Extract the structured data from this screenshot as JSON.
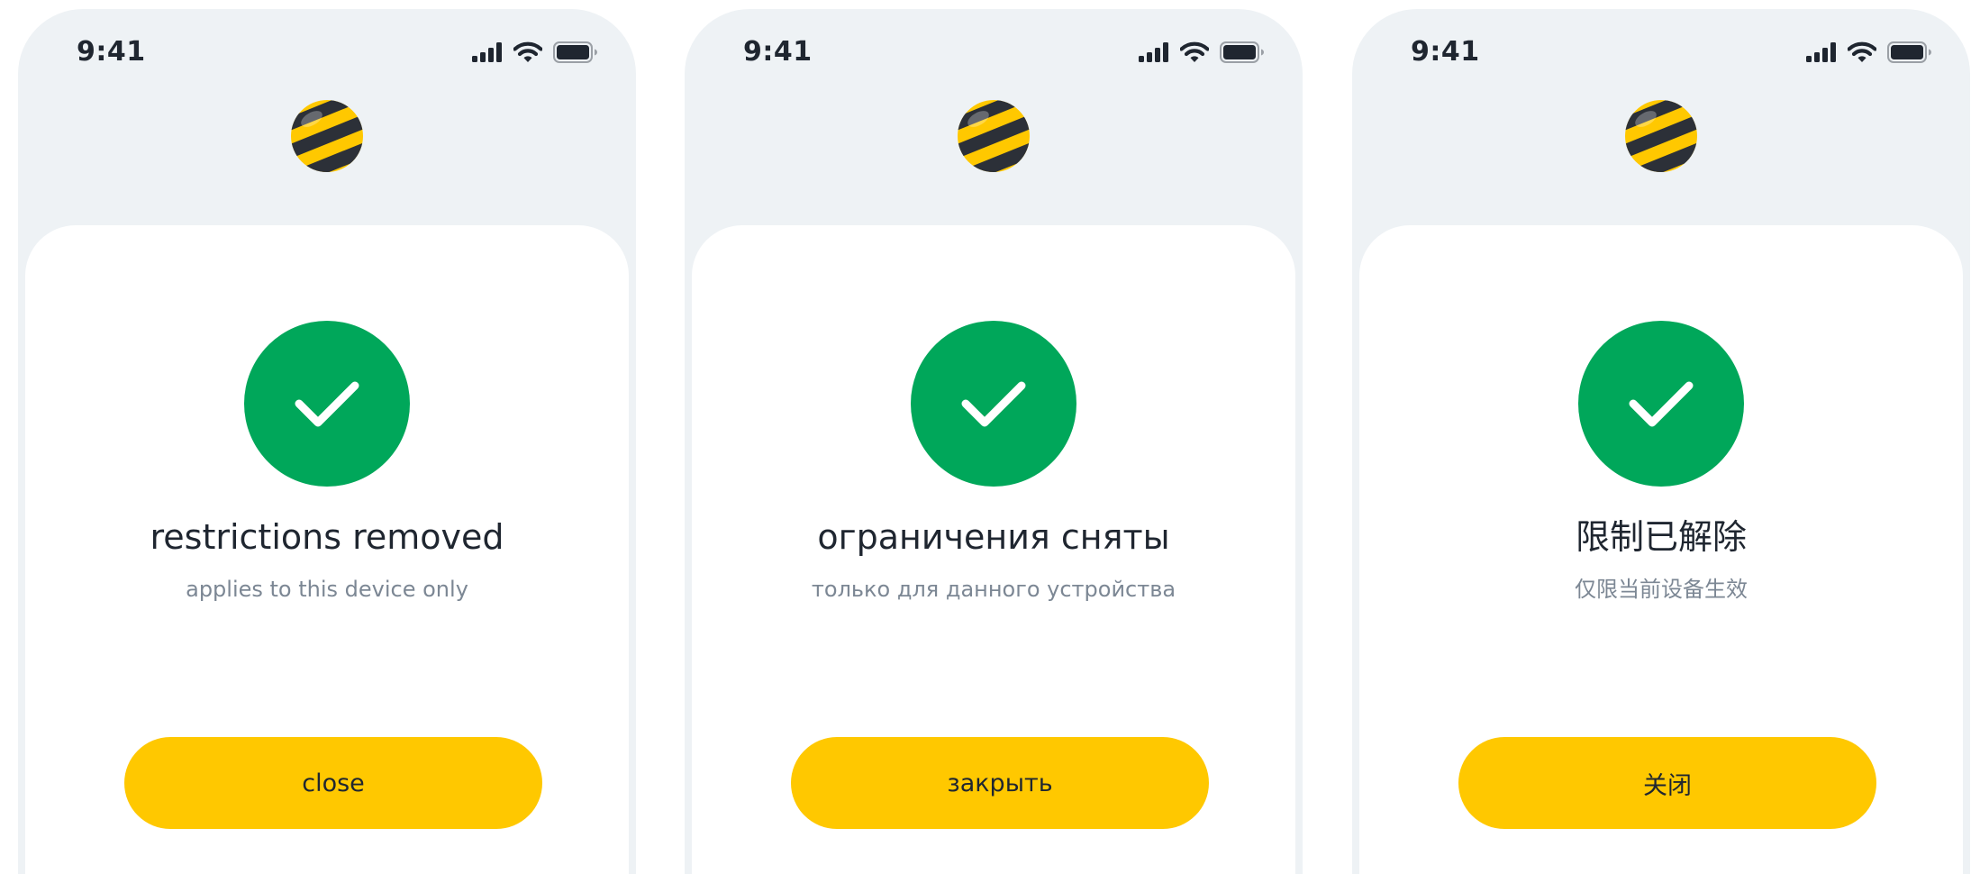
{
  "colors": {
    "screen_background": "#eef2f5",
    "card_background": "#ffffff",
    "success_green": "#00a75a",
    "button_yellow": "#ffc800",
    "title_text": "#1f2630",
    "subtitle_text": "#7c8794"
  },
  "icons": {
    "signal": "cellular-signal-icon",
    "wifi": "wifi-icon",
    "battery": "battery-icon",
    "logo": "beeline-logo",
    "success": "checkmark-icon"
  },
  "screens": [
    {
      "language": "en",
      "status_bar": {
        "time": "9:41"
      },
      "title": "restrictions removed",
      "subtitle": "applies to this device only",
      "close_label": "close"
    },
    {
      "language": "ru",
      "status_bar": {
        "time": "9:41"
      },
      "title": "ограничения сняты",
      "subtitle": "только для данного устройства",
      "close_label": "закрыть"
    },
    {
      "language": "zh",
      "status_bar": {
        "time": "9:41"
      },
      "title": "限制已解除",
      "subtitle": "仅限当前设备生效",
      "close_label": "关闭"
    }
  ]
}
